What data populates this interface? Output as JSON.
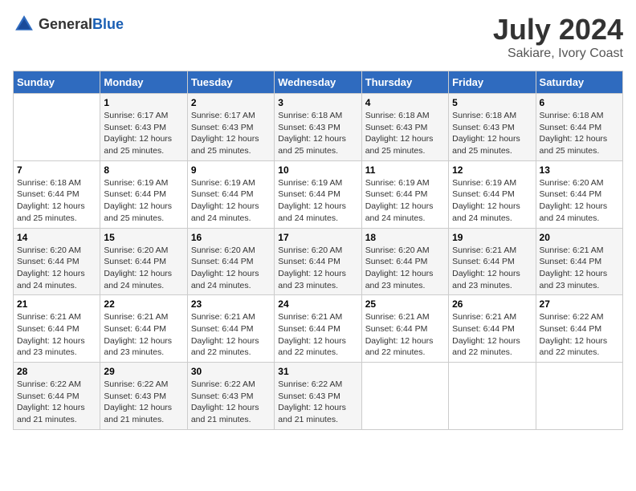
{
  "header": {
    "logo_general": "General",
    "logo_blue": "Blue",
    "month_year": "July 2024",
    "location": "Sakiare, Ivory Coast"
  },
  "days_of_week": [
    "Sunday",
    "Monday",
    "Tuesday",
    "Wednesday",
    "Thursday",
    "Friday",
    "Saturday"
  ],
  "weeks": [
    [
      {
        "day": "",
        "sunrise": "",
        "sunset": "",
        "daylight": ""
      },
      {
        "day": "1",
        "sunrise": "Sunrise: 6:17 AM",
        "sunset": "Sunset: 6:43 PM",
        "daylight": "Daylight: 12 hours and 25 minutes."
      },
      {
        "day": "2",
        "sunrise": "Sunrise: 6:17 AM",
        "sunset": "Sunset: 6:43 PM",
        "daylight": "Daylight: 12 hours and 25 minutes."
      },
      {
        "day": "3",
        "sunrise": "Sunrise: 6:18 AM",
        "sunset": "Sunset: 6:43 PM",
        "daylight": "Daylight: 12 hours and 25 minutes."
      },
      {
        "day": "4",
        "sunrise": "Sunrise: 6:18 AM",
        "sunset": "Sunset: 6:43 PM",
        "daylight": "Daylight: 12 hours and 25 minutes."
      },
      {
        "day": "5",
        "sunrise": "Sunrise: 6:18 AM",
        "sunset": "Sunset: 6:43 PM",
        "daylight": "Daylight: 12 hours and 25 minutes."
      },
      {
        "day": "6",
        "sunrise": "Sunrise: 6:18 AM",
        "sunset": "Sunset: 6:44 PM",
        "daylight": "Daylight: 12 hours and 25 minutes."
      }
    ],
    [
      {
        "day": "7",
        "sunrise": "Sunrise: 6:18 AM",
        "sunset": "Sunset: 6:44 PM",
        "daylight": "Daylight: 12 hours and 25 minutes."
      },
      {
        "day": "8",
        "sunrise": "Sunrise: 6:19 AM",
        "sunset": "Sunset: 6:44 PM",
        "daylight": "Daylight: 12 hours and 25 minutes."
      },
      {
        "day": "9",
        "sunrise": "Sunrise: 6:19 AM",
        "sunset": "Sunset: 6:44 PM",
        "daylight": "Daylight: 12 hours and 24 minutes."
      },
      {
        "day": "10",
        "sunrise": "Sunrise: 6:19 AM",
        "sunset": "Sunset: 6:44 PM",
        "daylight": "Daylight: 12 hours and 24 minutes."
      },
      {
        "day": "11",
        "sunrise": "Sunrise: 6:19 AM",
        "sunset": "Sunset: 6:44 PM",
        "daylight": "Daylight: 12 hours and 24 minutes."
      },
      {
        "day": "12",
        "sunrise": "Sunrise: 6:19 AM",
        "sunset": "Sunset: 6:44 PM",
        "daylight": "Daylight: 12 hours and 24 minutes."
      },
      {
        "day": "13",
        "sunrise": "Sunrise: 6:20 AM",
        "sunset": "Sunset: 6:44 PM",
        "daylight": "Daylight: 12 hours and 24 minutes."
      }
    ],
    [
      {
        "day": "14",
        "sunrise": "Sunrise: 6:20 AM",
        "sunset": "Sunset: 6:44 PM",
        "daylight": "Daylight: 12 hours and 24 minutes."
      },
      {
        "day": "15",
        "sunrise": "Sunrise: 6:20 AM",
        "sunset": "Sunset: 6:44 PM",
        "daylight": "Daylight: 12 hours and 24 minutes."
      },
      {
        "day": "16",
        "sunrise": "Sunrise: 6:20 AM",
        "sunset": "Sunset: 6:44 PM",
        "daylight": "Daylight: 12 hours and 24 minutes."
      },
      {
        "day": "17",
        "sunrise": "Sunrise: 6:20 AM",
        "sunset": "Sunset: 6:44 PM",
        "daylight": "Daylight: 12 hours and 23 minutes."
      },
      {
        "day": "18",
        "sunrise": "Sunrise: 6:20 AM",
        "sunset": "Sunset: 6:44 PM",
        "daylight": "Daylight: 12 hours and 23 minutes."
      },
      {
        "day": "19",
        "sunrise": "Sunrise: 6:21 AM",
        "sunset": "Sunset: 6:44 PM",
        "daylight": "Daylight: 12 hours and 23 minutes."
      },
      {
        "day": "20",
        "sunrise": "Sunrise: 6:21 AM",
        "sunset": "Sunset: 6:44 PM",
        "daylight": "Daylight: 12 hours and 23 minutes."
      }
    ],
    [
      {
        "day": "21",
        "sunrise": "Sunrise: 6:21 AM",
        "sunset": "Sunset: 6:44 PM",
        "daylight": "Daylight: 12 hours and 23 minutes."
      },
      {
        "day": "22",
        "sunrise": "Sunrise: 6:21 AM",
        "sunset": "Sunset: 6:44 PM",
        "daylight": "Daylight: 12 hours and 23 minutes."
      },
      {
        "day": "23",
        "sunrise": "Sunrise: 6:21 AM",
        "sunset": "Sunset: 6:44 PM",
        "daylight": "Daylight: 12 hours and 22 minutes."
      },
      {
        "day": "24",
        "sunrise": "Sunrise: 6:21 AM",
        "sunset": "Sunset: 6:44 PM",
        "daylight": "Daylight: 12 hours and 22 minutes."
      },
      {
        "day": "25",
        "sunrise": "Sunrise: 6:21 AM",
        "sunset": "Sunset: 6:44 PM",
        "daylight": "Daylight: 12 hours and 22 minutes."
      },
      {
        "day": "26",
        "sunrise": "Sunrise: 6:21 AM",
        "sunset": "Sunset: 6:44 PM",
        "daylight": "Daylight: 12 hours and 22 minutes."
      },
      {
        "day": "27",
        "sunrise": "Sunrise: 6:22 AM",
        "sunset": "Sunset: 6:44 PM",
        "daylight": "Daylight: 12 hours and 22 minutes."
      }
    ],
    [
      {
        "day": "28",
        "sunrise": "Sunrise: 6:22 AM",
        "sunset": "Sunset: 6:44 PM",
        "daylight": "Daylight: 12 hours and 21 minutes."
      },
      {
        "day": "29",
        "sunrise": "Sunrise: 6:22 AM",
        "sunset": "Sunset: 6:43 PM",
        "daylight": "Daylight: 12 hours and 21 minutes."
      },
      {
        "day": "30",
        "sunrise": "Sunrise: 6:22 AM",
        "sunset": "Sunset: 6:43 PM",
        "daylight": "Daylight: 12 hours and 21 minutes."
      },
      {
        "day": "31",
        "sunrise": "Sunrise: 6:22 AM",
        "sunset": "Sunset: 6:43 PM",
        "daylight": "Daylight: 12 hours and 21 minutes."
      },
      {
        "day": "",
        "sunrise": "",
        "sunset": "",
        "daylight": ""
      },
      {
        "day": "",
        "sunrise": "",
        "sunset": "",
        "daylight": ""
      },
      {
        "day": "",
        "sunrise": "",
        "sunset": "",
        "daylight": ""
      }
    ]
  ]
}
